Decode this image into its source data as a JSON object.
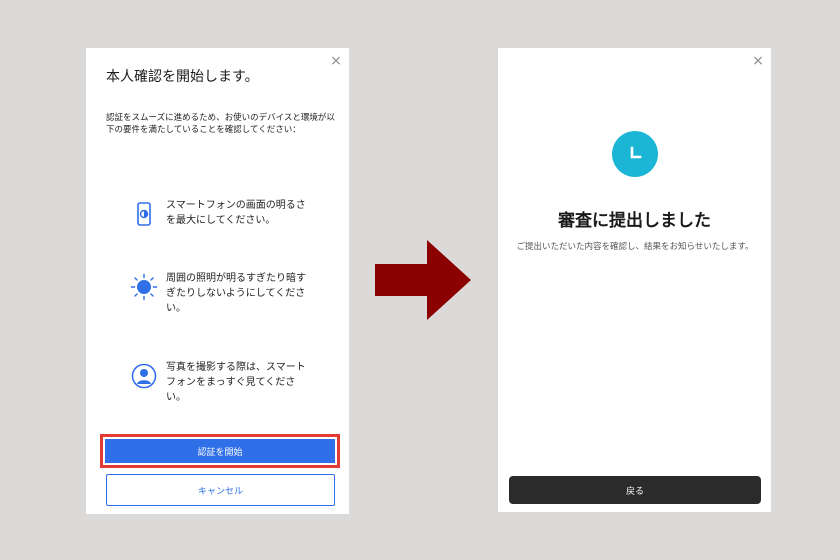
{
  "left_modal": {
    "close_glyph": "×",
    "title": "本人確認を開始します。",
    "intro": "認証をスムーズに進めるため、お使いのデバイスと環境が以下の要件を満たしていることを確認してください：",
    "requirements": [
      {
        "icon": "phone-brightness-icon",
        "text": "スマートフォンの画面の明るさを最大にしてください。"
      },
      {
        "icon": "sun-icon",
        "text": "周囲の照明が明るすぎたり暗すぎたりしないようにしてください。"
      },
      {
        "icon": "user-portrait-icon",
        "text": "写真を撮影する際は、スマートフォンをまっすぐ見てください。"
      }
    ],
    "start_label": "認証を開始",
    "cancel_label": "キャンセル"
  },
  "right_modal": {
    "close_glyph": "×",
    "status_icon": "clock-icon",
    "title": "審査に提出しました",
    "message": "ご提出いただいた内容を確認し、結果をお知らせいたします。",
    "back_label": "戻る"
  },
  "colors": {
    "primary": "#2f6fe8",
    "highlight": "#e53935",
    "status": "#1bb6d6",
    "arrow": "#8b0000",
    "dark_button": "#2b2b2b"
  }
}
